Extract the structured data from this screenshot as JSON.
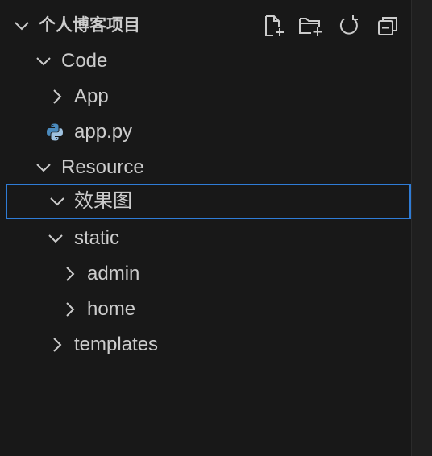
{
  "explorer": {
    "section_title": "个人博客项目",
    "toolbar": [
      {
        "name": "new-file-icon",
        "action": "New File"
      },
      {
        "name": "new-folder-icon",
        "action": "New Folder"
      },
      {
        "name": "refresh-icon",
        "action": "Refresh Explorer"
      },
      {
        "name": "collapse-all-icon",
        "action": "Collapse Folders"
      }
    ],
    "tree": [
      {
        "label": "Code",
        "type": "folder",
        "expanded": true,
        "depth": 0
      },
      {
        "label": "App",
        "type": "folder",
        "expanded": false,
        "depth": 1
      },
      {
        "label": "app.py",
        "type": "python-file",
        "depth": 1
      },
      {
        "label": "Resource",
        "type": "folder",
        "expanded": true,
        "depth": 0
      },
      {
        "label": "效果图",
        "type": "folder",
        "expanded": true,
        "depth": 1,
        "selected": true
      },
      {
        "label": "static",
        "type": "folder",
        "expanded": true,
        "depth": 1
      },
      {
        "label": "admin",
        "type": "folder",
        "expanded": false,
        "depth": 2
      },
      {
        "label": "home",
        "type": "folder",
        "expanded": false,
        "depth": 2
      },
      {
        "label": "templates",
        "type": "folder",
        "expanded": false,
        "depth": 1
      }
    ]
  },
  "colors": {
    "background": "#181818",
    "text": "#cccccc",
    "selection_border": "#2f7cd6",
    "indent_guide": "#585858",
    "python_icon_blue": "#4b8bbe",
    "python_icon_light": "#9fc2e0"
  }
}
